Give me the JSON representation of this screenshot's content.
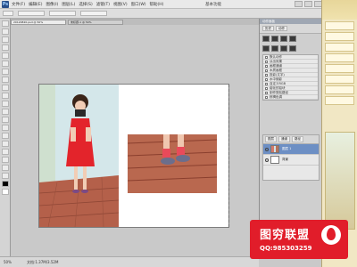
{
  "app": {
    "logo": "Ps",
    "menus": [
      "文件(F)",
      "编辑(E)",
      "图像(I)",
      "图层(L)",
      "选择(S)",
      "滤镜(T)",
      "视图(V)",
      "窗口(W)",
      "帮助(H)"
    ],
    "workspace_label": "基本功能"
  },
  "tabs": [
    {
      "label": "20120820.psd @ 50%"
    },
    {
      "label": "未标题-1 @ 50%"
    }
  ],
  "toolbox": {
    "tools": [
      "move",
      "marquee",
      "lasso",
      "magic-wand",
      "crop",
      "eyedropper",
      "healing",
      "brush",
      "stamp",
      "history",
      "eraser",
      "gradient",
      "blur",
      "dodge",
      "pen",
      "type",
      "path",
      "shape",
      "hand",
      "zoom",
      "foreground",
      "background",
      "quickmask",
      "screenmode"
    ]
  },
  "panels": {
    "actions": {
      "title": "动作面板",
      "tabs": [
        "历史",
        "动作"
      ],
      "items": [
        "默认动作",
        "淡出效果",
        "画框通道",
        "木质画框",
        "投影(文字)",
        "水中倒影",
        "自定义RGB",
        "熔化的铅块",
        "制作剪贴路径",
        "棕褐色调"
      ]
    },
    "layers": {
      "tabs": [
        "图层",
        "通道",
        "路径"
      ],
      "rows": [
        {
          "name": "图层 1",
          "selected": true
        },
        {
          "name": "背景",
          "selected": false
        }
      ]
    }
  },
  "status": {
    "zoom": "50%",
    "doc": "文档:1.37M/3.52M"
  },
  "watermark": {
    "title": "图穷联盟",
    "qq": "QQ:985303259"
  },
  "colors": {
    "badge": "#e11d2a",
    "selection": "#6d8fc4"
  }
}
